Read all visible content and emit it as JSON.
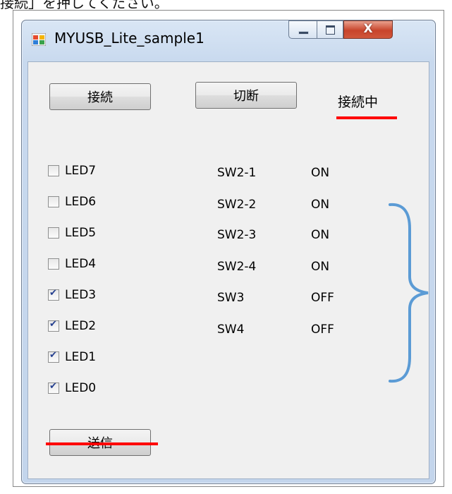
{
  "caption": "接続」を押してください。",
  "window": {
    "title": "MYUSB_Lite_sample1",
    "controls": {
      "close_glyph": "X"
    }
  },
  "buttons": {
    "connect": "接続",
    "disconnect": "切断",
    "send": "送信"
  },
  "status": "接続中",
  "leds": [
    {
      "label": "LED7",
      "checked": false
    },
    {
      "label": "LED6",
      "checked": false
    },
    {
      "label": "LED5",
      "checked": false
    },
    {
      "label": "LED4",
      "checked": false
    },
    {
      "label": "LED3",
      "checked": true
    },
    {
      "label": "LED2",
      "checked": true
    },
    {
      "label": "LED1",
      "checked": true
    },
    {
      "label": "LED0",
      "checked": true
    }
  ],
  "switches": [
    {
      "name": "SW2-1",
      "state": "ON"
    },
    {
      "name": "SW2-2",
      "state": "ON"
    },
    {
      "name": "SW2-3",
      "state": "ON"
    },
    {
      "name": "SW2-4",
      "state": "ON"
    },
    {
      "name": "SW3",
      "state": "OFF"
    },
    {
      "name": "SW4",
      "state": "OFF"
    }
  ],
  "colors": {
    "highlight": "#ff0000",
    "brace": "#5b9bd5"
  }
}
